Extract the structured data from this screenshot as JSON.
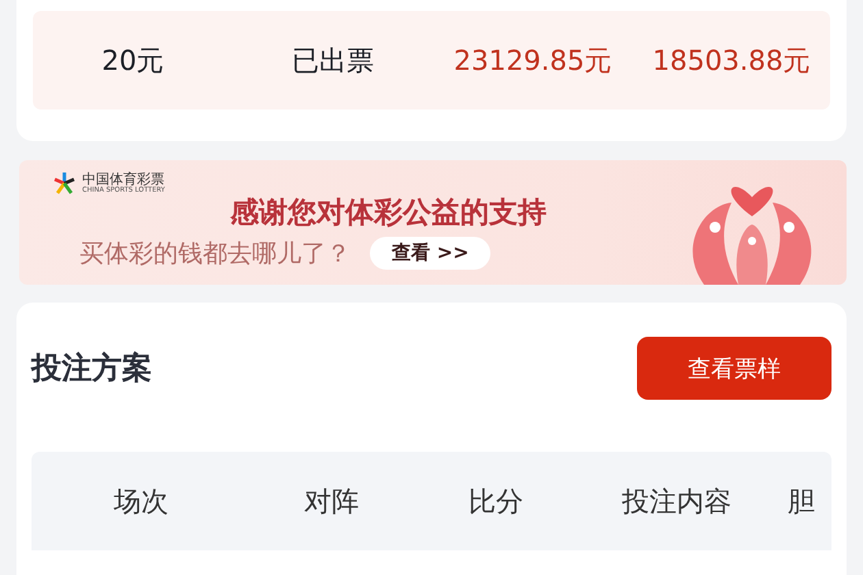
{
  "order_row": {
    "cells": [
      {
        "text": "20元",
        "kind": "plain"
      },
      {
        "text": "已出票",
        "kind": "plain"
      },
      {
        "text": "23129.85元",
        "kind": "amount"
      },
      {
        "text": "18503.88元",
        "kind": "amount"
      }
    ]
  },
  "banner": {
    "logo_cn": "中国体育彩票",
    "logo_en": "CHINA SPORTS LOTTERY",
    "headline": "感谢您对体彩公益的支持",
    "question": "买体彩的钱都去哪儿了？",
    "link": "查看 >>"
  },
  "plan": {
    "title": "投注方案",
    "button": "查看票样",
    "columns": [
      "场次",
      "对阵",
      "比分",
      "投注内容",
      "胆"
    ]
  }
}
